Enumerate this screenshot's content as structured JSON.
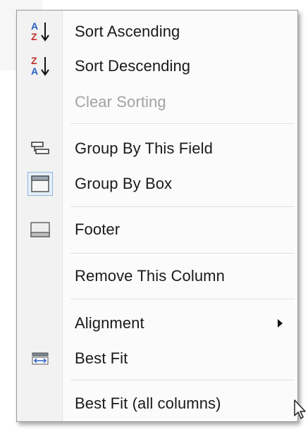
{
  "menu": {
    "items": [
      {
        "label": "Sort Ascending",
        "icon": "sort-ascending-icon",
        "enabled": true
      },
      {
        "label": "Sort Descending",
        "icon": "sort-descending-icon",
        "enabled": true
      },
      {
        "label": "Clear Sorting",
        "icon": "",
        "enabled": false
      },
      {
        "label": "Group By This Field",
        "icon": "group-by-field-icon",
        "enabled": true
      },
      {
        "label": "Group By Box",
        "icon": "group-by-box-icon",
        "enabled": true,
        "checked": true
      },
      {
        "label": "Footer",
        "icon": "footer-icon",
        "enabled": true
      },
      {
        "label": "Remove This Column",
        "icon": "",
        "enabled": true
      },
      {
        "label": "Alignment",
        "icon": "",
        "enabled": true,
        "has_submenu": true
      },
      {
        "label": "Best Fit",
        "icon": "best-fit-icon",
        "enabled": true
      },
      {
        "label": "Best Fit (all columns)",
        "icon": "",
        "enabled": true
      }
    ],
    "sort_icon_letters": {
      "a": "A",
      "z": "Z"
    }
  },
  "colors": {
    "text": "#1a1a1a",
    "disabled_text": "#a2a2a2",
    "sort_letter_a": "#2b5fc4",
    "sort_letter_z": "#c0302b",
    "checked_highlight": "#e6f0fb"
  }
}
